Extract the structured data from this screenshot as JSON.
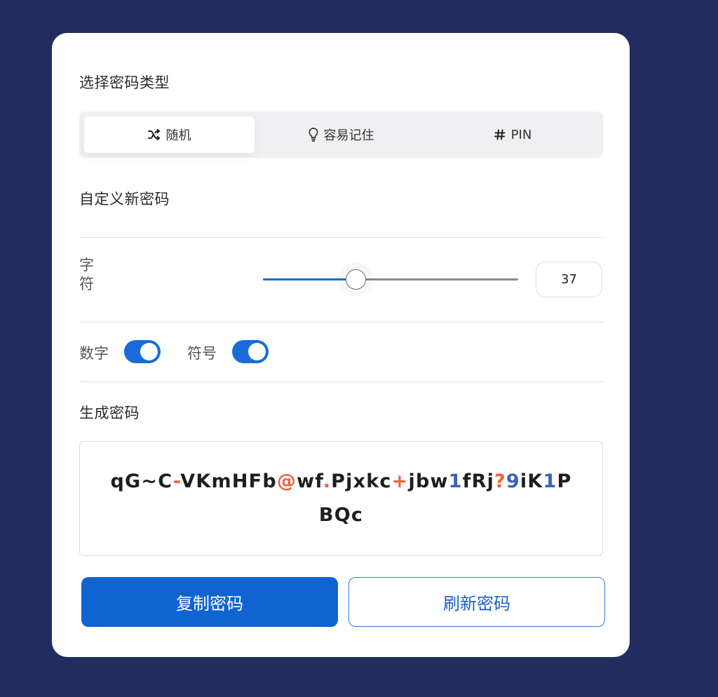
{
  "type_section": {
    "title": "选择密码类型",
    "tabs": [
      {
        "label": "随机",
        "icon": "shuffle-icon",
        "active": true
      },
      {
        "label": "容易记住",
        "icon": "lightbulb-icon",
        "active": false
      },
      {
        "label": "PIN",
        "icon": "hash-icon",
        "active": false
      }
    ]
  },
  "custom_section": {
    "title": "自定义新密码",
    "length_label": "字符",
    "length_value": "37",
    "length_min": 1,
    "length_max": 100,
    "length_slider_value": 37,
    "options": [
      {
        "label": "数字",
        "enabled": true
      },
      {
        "label": "符号",
        "enabled": true
      }
    ]
  },
  "generated_section": {
    "title": "生成密码",
    "password": "qG~C-VKmHFb@wf.Pjxkc+jbw1fRj?9iK1PBQc"
  },
  "actions": {
    "copy_label": "复制密码",
    "refresh_label": "刷新密码"
  },
  "colors": {
    "background": "#222c5f",
    "accent": "#1a6bd8",
    "symbol": "#f0623e",
    "digit": "#3a63b8"
  }
}
